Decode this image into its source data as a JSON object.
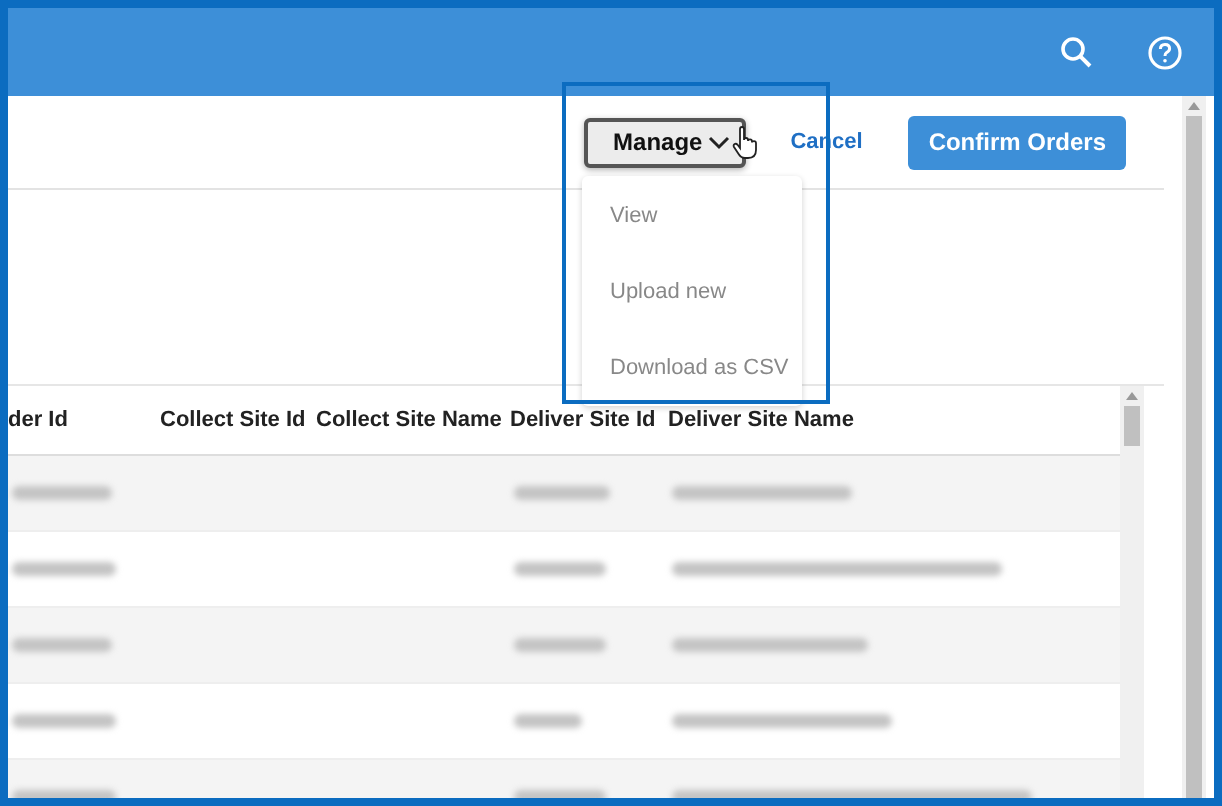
{
  "header": {
    "actions": [
      {
        "kind": "search"
      },
      {
        "kind": "help"
      }
    ]
  },
  "toolbar": {
    "manage": {
      "label": "Manage",
      "expanded": true
    },
    "cancel": "Cancel",
    "confirm": "Confirm Orders"
  },
  "manage_menu": [
    "View",
    "Upload new",
    "Download as CSV"
  ],
  "table": {
    "columns": [
      "der Id",
      "Collect Site Id",
      "Collect Site Name",
      "Deliver Site Id",
      "Deliver Site Name"
    ],
    "rows": [
      {
        "cells": [
          {
            "kind": "blurred"
          },
          {
            "kind": "empty"
          },
          {
            "kind": "empty"
          },
          {
            "kind": "blurred"
          },
          {
            "kind": "blurred"
          }
        ]
      },
      {
        "cells": [
          {
            "kind": "blurred"
          },
          {
            "kind": "empty"
          },
          {
            "kind": "empty"
          },
          {
            "kind": "blurred"
          },
          {
            "kind": "blurred"
          }
        ]
      },
      {
        "cells": [
          {
            "kind": "blurred"
          },
          {
            "kind": "empty"
          },
          {
            "kind": "empty"
          },
          {
            "kind": "blurred"
          },
          {
            "kind": "blurred"
          }
        ]
      },
      {
        "cells": [
          {
            "kind": "blurred"
          },
          {
            "kind": "empty"
          },
          {
            "kind": "empty"
          },
          {
            "kind": "blurred"
          },
          {
            "kind": "blurred"
          }
        ]
      },
      {
        "cells": [
          {
            "kind": "blurred"
          },
          {
            "kind": "empty"
          },
          {
            "kind": "empty"
          },
          {
            "kind": "blurred"
          },
          {
            "kind": "blurred"
          }
        ]
      }
    ]
  }
}
